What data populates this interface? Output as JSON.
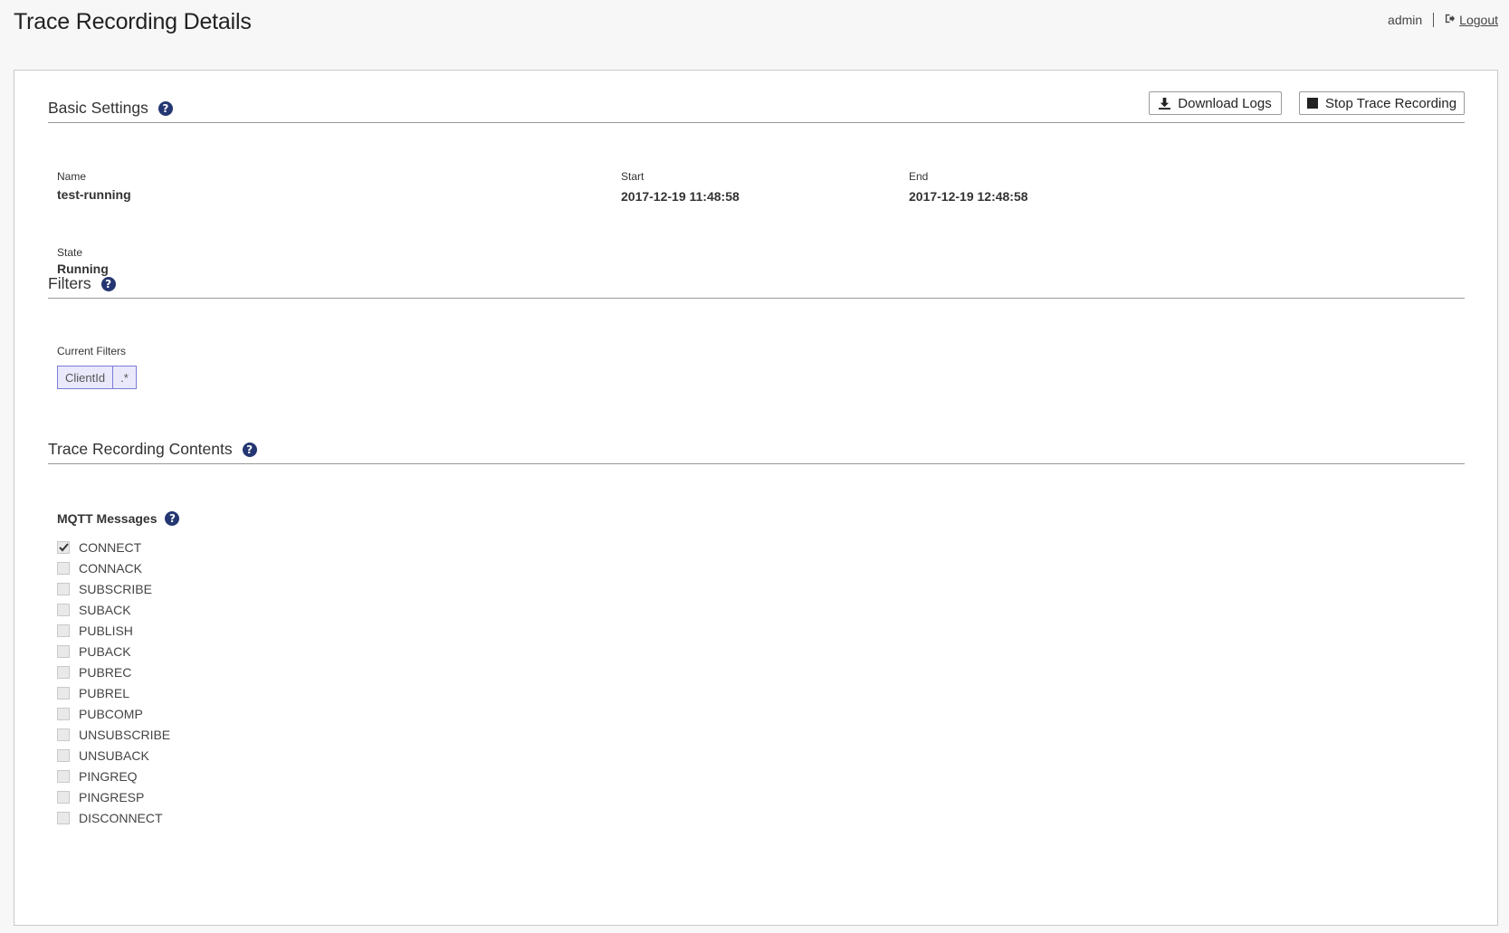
{
  "page": {
    "title": "Trace Recording Details"
  },
  "user": {
    "name": "admin",
    "logout": "Logout"
  },
  "basic_settings": {
    "title": "Basic Settings",
    "download_label": "Download Logs",
    "stop_label": "Stop Trace Recording",
    "name_label": "Name",
    "name_value": "test-running",
    "start_label": "Start",
    "start_value": "2017-12-19 11:48:58",
    "end_label": "End",
    "end_value": "2017-12-19 12:48:58",
    "state_label": "State",
    "state_value": "Running"
  },
  "filters": {
    "title": "Filters",
    "current_label": "Current Filters",
    "items": [
      {
        "key": "ClientId",
        "value": ".*"
      }
    ]
  },
  "contents": {
    "title": "Trace Recording Contents",
    "mqtt_title": "MQTT Messages",
    "messages": [
      {
        "label": "CONNECT",
        "checked": true
      },
      {
        "label": "CONNACK",
        "checked": false
      },
      {
        "label": "SUBSCRIBE",
        "checked": false
      },
      {
        "label": "SUBACK",
        "checked": false
      },
      {
        "label": "PUBLISH",
        "checked": false
      },
      {
        "label": "PUBACK",
        "checked": false
      },
      {
        "label": "PUBREC",
        "checked": false
      },
      {
        "label": "PUBREL",
        "checked": false
      },
      {
        "label": "PUBCOMP",
        "checked": false
      },
      {
        "label": "UNSUBSCRIBE",
        "checked": false
      },
      {
        "label": "UNSUBACK",
        "checked": false
      },
      {
        "label": "PINGREQ",
        "checked": false
      },
      {
        "label": "PINGRESP",
        "checked": false
      },
      {
        "label": "DISCONNECT",
        "checked": false
      }
    ]
  },
  "colors": {
    "accent": "#253772",
    "filter_border": "#7c7cd8",
    "filter_bg": "#e9e9fb"
  }
}
